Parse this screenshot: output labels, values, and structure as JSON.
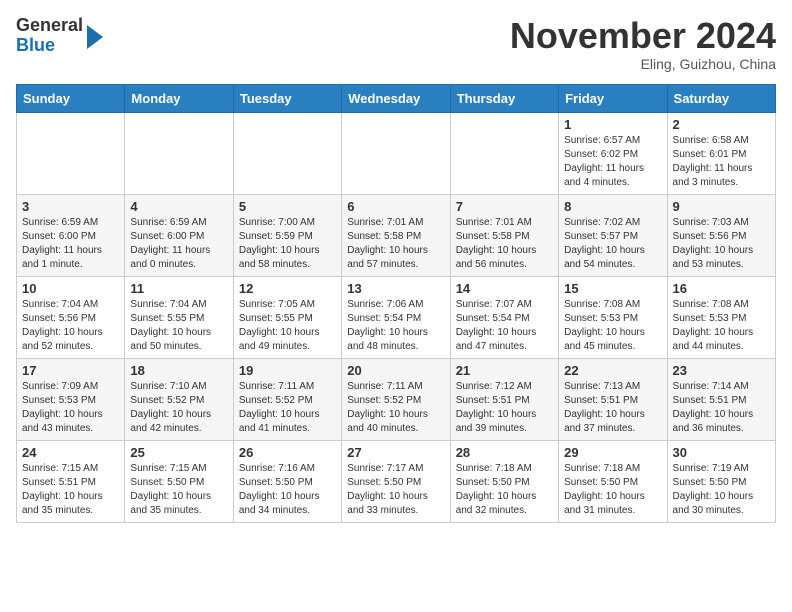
{
  "header": {
    "logo_line1": "General",
    "logo_line2": "Blue",
    "month": "November 2024",
    "location": "Eling, Guizhou, China"
  },
  "weekdays": [
    "Sunday",
    "Monday",
    "Tuesday",
    "Wednesday",
    "Thursday",
    "Friday",
    "Saturday"
  ],
  "weeks": [
    [
      {
        "day": "",
        "info": ""
      },
      {
        "day": "",
        "info": ""
      },
      {
        "day": "",
        "info": ""
      },
      {
        "day": "",
        "info": ""
      },
      {
        "day": "",
        "info": ""
      },
      {
        "day": "1",
        "info": "Sunrise: 6:57 AM\nSunset: 6:02 PM\nDaylight: 11 hours and 4 minutes."
      },
      {
        "day": "2",
        "info": "Sunrise: 6:58 AM\nSunset: 6:01 PM\nDaylight: 11 hours and 3 minutes."
      }
    ],
    [
      {
        "day": "3",
        "info": "Sunrise: 6:59 AM\nSunset: 6:00 PM\nDaylight: 11 hours and 1 minute."
      },
      {
        "day": "4",
        "info": "Sunrise: 6:59 AM\nSunset: 6:00 PM\nDaylight: 11 hours and 0 minutes."
      },
      {
        "day": "5",
        "info": "Sunrise: 7:00 AM\nSunset: 5:59 PM\nDaylight: 10 hours and 58 minutes."
      },
      {
        "day": "6",
        "info": "Sunrise: 7:01 AM\nSunset: 5:58 PM\nDaylight: 10 hours and 57 minutes."
      },
      {
        "day": "7",
        "info": "Sunrise: 7:01 AM\nSunset: 5:58 PM\nDaylight: 10 hours and 56 minutes."
      },
      {
        "day": "8",
        "info": "Sunrise: 7:02 AM\nSunset: 5:57 PM\nDaylight: 10 hours and 54 minutes."
      },
      {
        "day": "9",
        "info": "Sunrise: 7:03 AM\nSunset: 5:56 PM\nDaylight: 10 hours and 53 minutes."
      }
    ],
    [
      {
        "day": "10",
        "info": "Sunrise: 7:04 AM\nSunset: 5:56 PM\nDaylight: 10 hours and 52 minutes."
      },
      {
        "day": "11",
        "info": "Sunrise: 7:04 AM\nSunset: 5:55 PM\nDaylight: 10 hours and 50 minutes."
      },
      {
        "day": "12",
        "info": "Sunrise: 7:05 AM\nSunset: 5:55 PM\nDaylight: 10 hours and 49 minutes."
      },
      {
        "day": "13",
        "info": "Sunrise: 7:06 AM\nSunset: 5:54 PM\nDaylight: 10 hours and 48 minutes."
      },
      {
        "day": "14",
        "info": "Sunrise: 7:07 AM\nSunset: 5:54 PM\nDaylight: 10 hours and 47 minutes."
      },
      {
        "day": "15",
        "info": "Sunrise: 7:08 AM\nSunset: 5:53 PM\nDaylight: 10 hours and 45 minutes."
      },
      {
        "day": "16",
        "info": "Sunrise: 7:08 AM\nSunset: 5:53 PM\nDaylight: 10 hours and 44 minutes."
      }
    ],
    [
      {
        "day": "17",
        "info": "Sunrise: 7:09 AM\nSunset: 5:53 PM\nDaylight: 10 hours and 43 minutes."
      },
      {
        "day": "18",
        "info": "Sunrise: 7:10 AM\nSunset: 5:52 PM\nDaylight: 10 hours and 42 minutes."
      },
      {
        "day": "19",
        "info": "Sunrise: 7:11 AM\nSunset: 5:52 PM\nDaylight: 10 hours and 41 minutes."
      },
      {
        "day": "20",
        "info": "Sunrise: 7:11 AM\nSunset: 5:52 PM\nDaylight: 10 hours and 40 minutes."
      },
      {
        "day": "21",
        "info": "Sunrise: 7:12 AM\nSunset: 5:51 PM\nDaylight: 10 hours and 39 minutes."
      },
      {
        "day": "22",
        "info": "Sunrise: 7:13 AM\nSunset: 5:51 PM\nDaylight: 10 hours and 37 minutes."
      },
      {
        "day": "23",
        "info": "Sunrise: 7:14 AM\nSunset: 5:51 PM\nDaylight: 10 hours and 36 minutes."
      }
    ],
    [
      {
        "day": "24",
        "info": "Sunrise: 7:15 AM\nSunset: 5:51 PM\nDaylight: 10 hours and 35 minutes."
      },
      {
        "day": "25",
        "info": "Sunrise: 7:15 AM\nSunset: 5:50 PM\nDaylight: 10 hours and 35 minutes."
      },
      {
        "day": "26",
        "info": "Sunrise: 7:16 AM\nSunset: 5:50 PM\nDaylight: 10 hours and 34 minutes."
      },
      {
        "day": "27",
        "info": "Sunrise: 7:17 AM\nSunset: 5:50 PM\nDaylight: 10 hours and 33 minutes."
      },
      {
        "day": "28",
        "info": "Sunrise: 7:18 AM\nSunset: 5:50 PM\nDaylight: 10 hours and 32 minutes."
      },
      {
        "day": "29",
        "info": "Sunrise: 7:18 AM\nSunset: 5:50 PM\nDaylight: 10 hours and 31 minutes."
      },
      {
        "day": "30",
        "info": "Sunrise: 7:19 AM\nSunset: 5:50 PM\nDaylight: 10 hours and 30 minutes."
      }
    ]
  ]
}
